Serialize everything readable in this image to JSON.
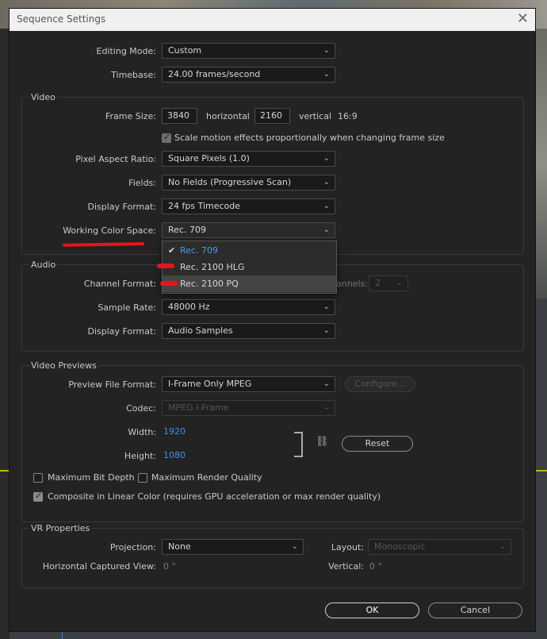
{
  "window": {
    "title": "Sequence Settings",
    "close_glyph": "✕"
  },
  "chevron": "⌄",
  "general": {
    "editing_mode": {
      "label": "Editing Mode:",
      "value": "Custom"
    },
    "timebase": {
      "label": "Timebase:",
      "value": "24.00  frames/second"
    }
  },
  "video": {
    "title": "Video",
    "frame_size": {
      "label": "Frame Size:",
      "horizontal": "3840",
      "horizontal_label": "horizontal",
      "vertical": "2160",
      "vertical_label": "vertical",
      "aspect": "16:9"
    },
    "scale_motion": {
      "label": "Scale motion effects proportionally when changing frame size",
      "checked": true
    },
    "pixel_aspect": {
      "label": "Pixel Aspect Ratio:",
      "value": "Square Pixels (1.0)"
    },
    "fields": {
      "label": "Fields:",
      "value": "No Fields (Progressive Scan)"
    },
    "display_format": {
      "label": "Display Format:",
      "value": "24 fps Timecode"
    },
    "working_color_space": {
      "label": "Working Color Space:",
      "value": "Rec. 709",
      "options": [
        "Rec. 709",
        "Rec. 2100 HLG",
        "Rec. 2100 PQ"
      ],
      "selected": "Rec. 709",
      "hovered": "Rec. 2100 PQ"
    }
  },
  "audio": {
    "title": "Audio",
    "channel_format": {
      "label": "Channel Format:"
    },
    "channels": {
      "label": "annels:",
      "value": "2"
    },
    "sample_rate": {
      "label": "Sample Rate:",
      "value": "48000 Hz"
    },
    "display_format": {
      "label": "Display Format:",
      "value": "Audio Samples"
    }
  },
  "previews": {
    "title": "Video Previews",
    "file_format": {
      "label": "Preview File Format:",
      "value": "I-Frame Only MPEG"
    },
    "configure_label": "Configure...",
    "codec": {
      "label": "Codec:",
      "value": "MPEG I-Frame"
    },
    "width": {
      "label": "Width:",
      "value": "1920"
    },
    "height": {
      "label": "Height:",
      "value": "1080"
    },
    "reset_label": "Reset",
    "max_bit_depth": {
      "label": "Maximum Bit Depth",
      "checked": false
    },
    "max_render_quality": {
      "label": "Maximum Render Quality",
      "checked": false
    },
    "composite_linear": {
      "label": "Composite in Linear Color (requires GPU acceleration or max render quality)",
      "checked": true
    }
  },
  "vr": {
    "title": "VR Properties",
    "projection": {
      "label": "Projection:",
      "value": "None"
    },
    "layout": {
      "label": "Layout:",
      "value": "Monoscopic"
    },
    "horizontal_view": {
      "label": "Horizontal Captured View:",
      "value": "0 °"
    },
    "vertical": {
      "label": "Vertical:",
      "value": "0 °"
    }
  },
  "footer": {
    "ok_label": "OK",
    "cancel_label": "Cancel"
  },
  "colors": {
    "annotation_red": "#e8141b",
    "link_blue": "#3f8fe6",
    "dialog_bg": "#232323"
  }
}
